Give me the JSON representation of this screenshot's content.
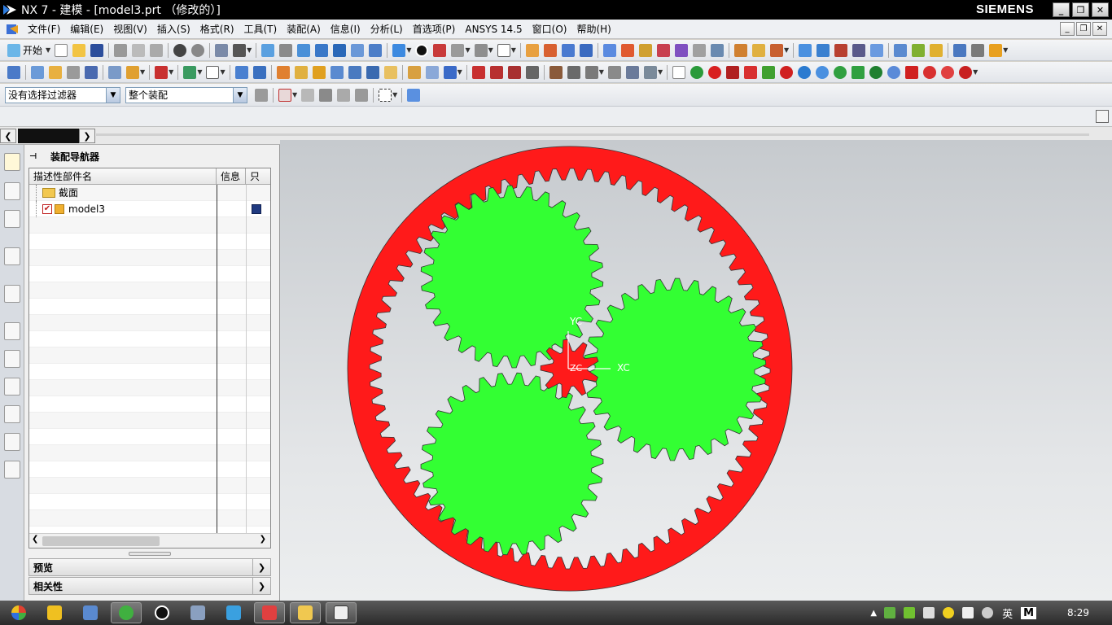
{
  "window": {
    "title": "NX 7 - 建模 - [model3.prt （修改的）]",
    "brand": "SIEMENS"
  },
  "menu": {
    "items": [
      "文件(F)",
      "编辑(E)",
      "视图(V)",
      "插入(S)",
      "格式(R)",
      "工具(T)",
      "装配(A)",
      "信息(I)",
      "分析(L)",
      "首选项(P)",
      "ANSYS 14.5",
      "窗口(O)",
      "帮助(H)"
    ]
  },
  "toolbar1": {
    "start_label": "开始"
  },
  "selection_bar": {
    "filter_value": "没有选择过滤器",
    "scope_value": "整个装配"
  },
  "navigator": {
    "title": "装配导航器",
    "columns": {
      "name": "描述性部件名",
      "info": "信息",
      "readonly": "只"
    },
    "rows": [
      {
        "label": "截面",
        "icon": "folder-icon"
      },
      {
        "label": "model3",
        "icon": "part-icon",
        "checked": true
      }
    ],
    "sections": {
      "preview": "预览",
      "dependencies": "相关性"
    }
  },
  "viewport": {
    "axis_labels": {
      "x": "XC",
      "y": "YC",
      "z": "ZC"
    },
    "colors": {
      "ring_gear": "#ff1a1a",
      "planet_gear": "#33ff33",
      "sun_gear": "#ff1a1a",
      "outline": "#333333"
    },
    "gear_teeth": {
      "ring": 72,
      "planet": 30,
      "sun": 9
    }
  },
  "taskbar": {
    "tray": {
      "lang": "英",
      "ime": "M",
      "clock": "8:29"
    }
  }
}
